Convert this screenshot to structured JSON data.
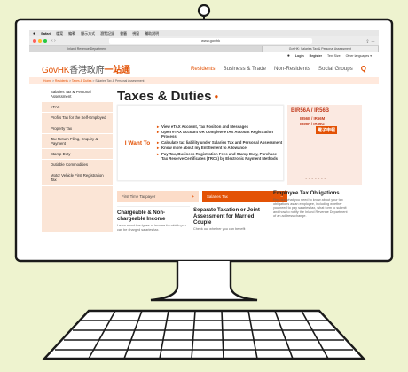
{
  "menubar": {
    "apple": "",
    "items": [
      "Safari",
      "檔案",
      "編輯",
      "顯示方式",
      "瀏覽記錄",
      "書籤",
      "視窗",
      "輔助說明"
    ]
  },
  "browser": {
    "url": "www.gov.hk",
    "tabs": [
      "Inland Revenue Department",
      "",
      "GovHK: Salaries Tax & Personal Assessment"
    ]
  },
  "utility": {
    "login": "Login",
    "register": "Register",
    "text_size": "Text Size",
    "languages": "Other languages ▾"
  },
  "header": {
    "logo_en": "GovHK",
    "logo_zh": "香港政府",
    "logo_zh2": "一站通",
    "nav": [
      "Residents",
      "Business & Trade",
      "Non-Residents",
      "Social Groups"
    ],
    "search": "Q"
  },
  "breadcrumb": [
    "Home",
    "Residents",
    "Taxes & Duties",
    "Salaries Tax & Personal Assessment"
  ],
  "sidebar": [
    "Salaries Tax & Personal Assessment",
    "eTAX",
    "Profits Tax for the Self-Employed",
    "Property Tax",
    "Tax Return Filing, Enquiry & Payment",
    "Stamp Duty",
    "Dutiable Commodities",
    "Motor Vehicle First Registration Tax"
  ],
  "page_title": "Taxes & Duties",
  "i_want_to": {
    "label": "I Want To",
    "items": [
      "View eTAX Account, Tax Position and Messages",
      "Open eTAX Account OR Complete eTAX Account Registration Process",
      "Calculate tax liability under Salaries Tax and Personal Assessment",
      "Know more about my Entitlement to Allowance",
      "Pay Tax, Business Registration Fees and Stamp Duty, Purchase Tax Reserve Certificates (TRCs) by Electronic Payment Methods"
    ]
  },
  "banner": {
    "l1": "BIR56A / IR56B",
    "l2": "IR56E / IR56M",
    "l3": "IR56F / IR56G",
    "l4": "電子申報"
  },
  "tiles": {
    "first_time": "First Time Taxpayer",
    "salaries": "Salaries Tax",
    "plus": "+",
    "minus": "–"
  },
  "cards": {
    "c1_title": "Chargeable & Non-chargeable Income",
    "c1_text": "Learn about the types of income for which you can be charged salaries tax.",
    "c2_title": "Separate Taxation or Joint Assessment for Married Couple",
    "c2_text": "Check out whether you can benefit",
    "c3_title": "Employee Tax Obligations",
    "c3_text": "Find out what you need to know about your tax obligations as an employee, including whether you need to pay salaries tax, what form to submit and how to notify the Inland Revenue Department of an address change."
  },
  "colors": {
    "brand": "#e35205",
    "background": "#eef3cf",
    "outline": "#1a1a1a"
  }
}
